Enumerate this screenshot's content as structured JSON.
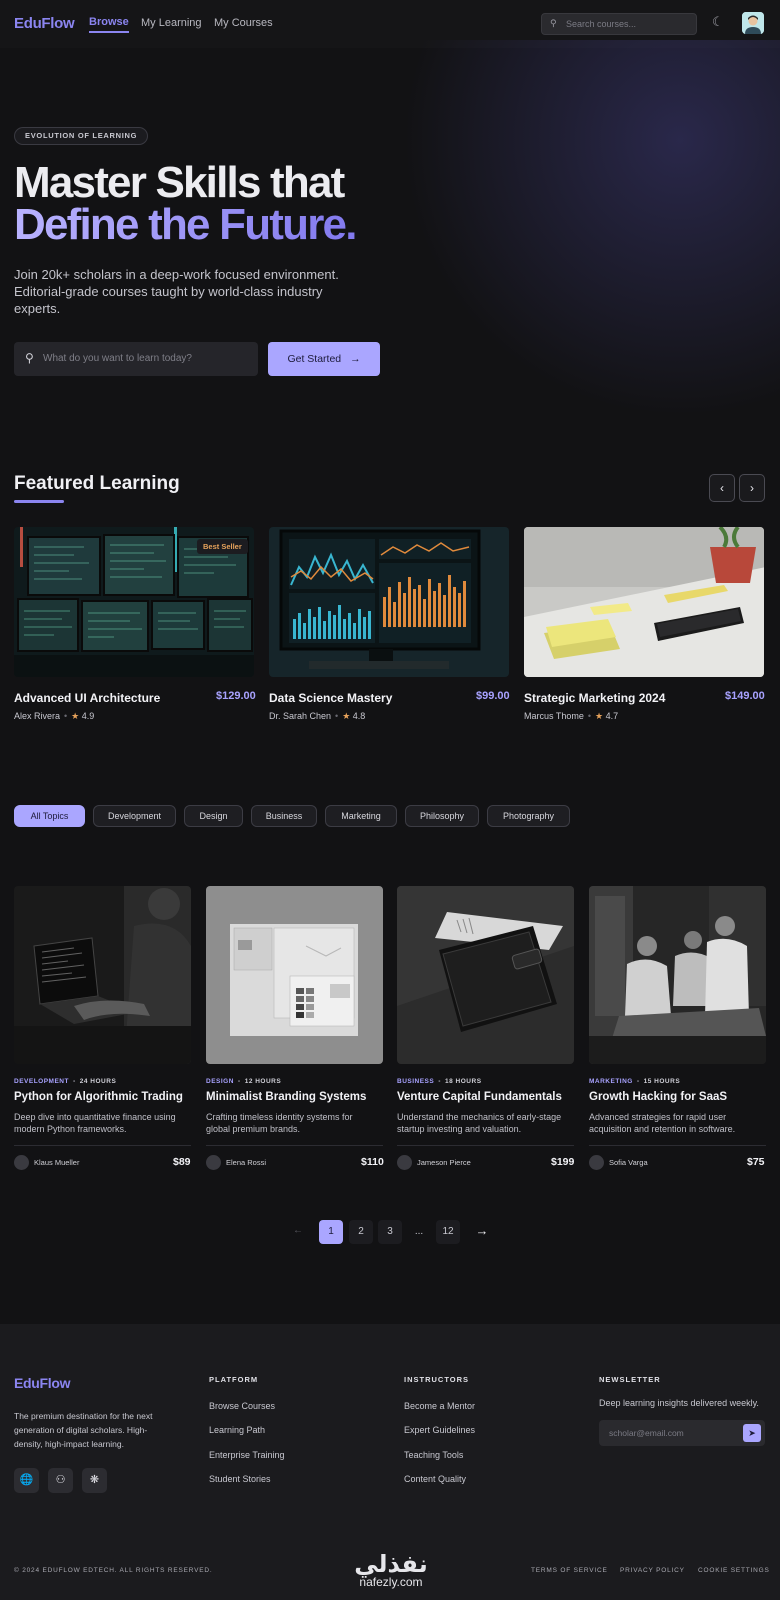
{
  "nav": {
    "logo": "EduFlow",
    "links": [
      "Browse",
      "My Learning",
      "My Courses"
    ],
    "search_placeholder": "Search courses...",
    "theme_icon": "moon-icon",
    "avatar_icon": "user-avatar"
  },
  "hero": {
    "badge": "EVOLUTION OF LEARNING",
    "title_line1": "Master Skills that",
    "title_line2": "Define the Future.",
    "subtitle": "Join 20k+ scholars in a deep-work focused environment. Editorial-grade courses taught by world-class industry experts.",
    "search_placeholder": "What do you want to learn today?",
    "cta_label": "Get Started",
    "accent_color": "#aaa6ff"
  },
  "featured": {
    "title": "Featured Learning",
    "courses": [
      {
        "title": "Advanced UI Architecture",
        "price": "$129.00",
        "author": "Alex Rivera",
        "rating": "4.9",
        "badge": "Best Seller"
      },
      {
        "title": "Data Science Mastery",
        "price": "$99.00",
        "author": "Dr. Sarah Chen",
        "rating": "4.8"
      },
      {
        "title": "Strategic Marketing 2024",
        "price": "$149.00",
        "author": "Marcus Thome",
        "rating": "4.7"
      }
    ]
  },
  "topics": [
    "All Topics",
    "Development",
    "Design",
    "Business",
    "Marketing",
    "Philosophy",
    "Photography"
  ],
  "courses": [
    {
      "category": "DEVELOPMENT",
      "hours": "24 HOURS",
      "title": "Python for Algorithmic Trading",
      "desc": "Deep dive into quantitative finance using modern Python frameworks.",
      "author": "Klaus Mueller",
      "price": "$89"
    },
    {
      "category": "DESIGN",
      "hours": "12 HOURS",
      "title": "Minimalist Branding Systems",
      "desc": "Crafting timeless identity systems for global premium brands.",
      "author": "Elena Rossi",
      "price": "$110"
    },
    {
      "category": "BUSINESS",
      "hours": "18 HOURS",
      "title": "Venture Capital Fundamentals",
      "desc": "Understand the mechanics of early-stage startup investing and valuation.",
      "author": "Jameson Pierce",
      "price": "$199"
    },
    {
      "category": "MARKETING",
      "hours": "15 HOURS",
      "title": "Growth Hacking for SaaS",
      "desc": "Advanced strategies for rapid user acquisition and retention in software.",
      "author": "Sofia Varga",
      "price": "$75"
    }
  ],
  "pagination": {
    "prev": "←",
    "pages": [
      "1",
      "2",
      "3",
      "...",
      "12"
    ],
    "next": "→",
    "current": "1"
  },
  "footer": {
    "logo": "EduFlow",
    "description": "The premium destination for the next generation of digital scholars. High-density, high-impact learning.",
    "social_icons": [
      "globe-icon",
      "community-icon",
      "network-icon"
    ],
    "columns": [
      {
        "heading": "PLATFORM",
        "links": [
          "Browse Courses",
          "Learning Path",
          "Enterprise Training",
          "Student Stories"
        ]
      },
      {
        "heading": "INSTRUCTORS",
        "links": [
          "Become a Mentor",
          "Expert Guidelines",
          "Teaching Tools",
          "Content Quality"
        ]
      }
    ],
    "newsletter": {
      "heading": "NEWSLETTER",
      "text": "Deep learning insights delivered weekly.",
      "placeholder": "scholar@email.com"
    },
    "copyright": "© 2024 EDUFLOW EDTECH. ALL RIGHTS RESERVED.",
    "legal_links": [
      "TERMS OF SERVICE",
      "PRIVACY POLICY",
      "COOKIE SETTINGS"
    ]
  },
  "watermark": {
    "arabic": "نفذلي",
    "latin": "nafezly.com"
  }
}
